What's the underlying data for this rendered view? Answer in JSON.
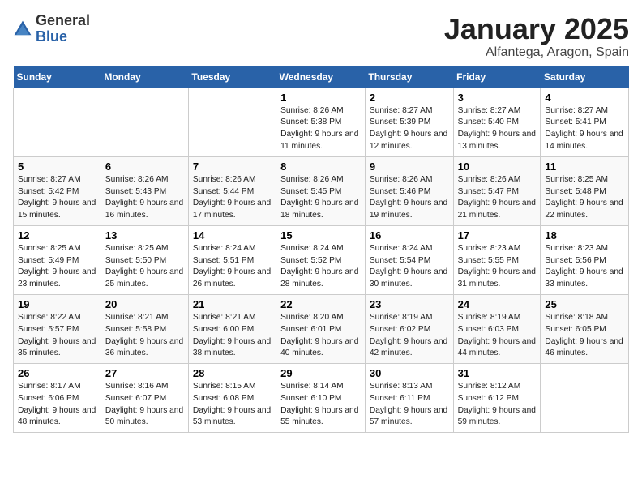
{
  "logo": {
    "general": "General",
    "blue": "Blue"
  },
  "title": "January 2025",
  "location": "Alfantega, Aragon, Spain",
  "days_of_week": [
    "Sunday",
    "Monday",
    "Tuesday",
    "Wednesday",
    "Thursday",
    "Friday",
    "Saturday"
  ],
  "weeks": [
    [
      {
        "day": "",
        "info": ""
      },
      {
        "day": "",
        "info": ""
      },
      {
        "day": "",
        "info": ""
      },
      {
        "day": "1",
        "info": "Sunrise: 8:26 AM\nSunset: 5:38 PM\nDaylight: 9 hours and 11 minutes."
      },
      {
        "day": "2",
        "info": "Sunrise: 8:27 AM\nSunset: 5:39 PM\nDaylight: 9 hours and 12 minutes."
      },
      {
        "day": "3",
        "info": "Sunrise: 8:27 AM\nSunset: 5:40 PM\nDaylight: 9 hours and 13 minutes."
      },
      {
        "day": "4",
        "info": "Sunrise: 8:27 AM\nSunset: 5:41 PM\nDaylight: 9 hours and 14 minutes."
      }
    ],
    [
      {
        "day": "5",
        "info": "Sunrise: 8:27 AM\nSunset: 5:42 PM\nDaylight: 9 hours and 15 minutes."
      },
      {
        "day": "6",
        "info": "Sunrise: 8:26 AM\nSunset: 5:43 PM\nDaylight: 9 hours and 16 minutes."
      },
      {
        "day": "7",
        "info": "Sunrise: 8:26 AM\nSunset: 5:44 PM\nDaylight: 9 hours and 17 minutes."
      },
      {
        "day": "8",
        "info": "Sunrise: 8:26 AM\nSunset: 5:45 PM\nDaylight: 9 hours and 18 minutes."
      },
      {
        "day": "9",
        "info": "Sunrise: 8:26 AM\nSunset: 5:46 PM\nDaylight: 9 hours and 19 minutes."
      },
      {
        "day": "10",
        "info": "Sunrise: 8:26 AM\nSunset: 5:47 PM\nDaylight: 9 hours and 21 minutes."
      },
      {
        "day": "11",
        "info": "Sunrise: 8:25 AM\nSunset: 5:48 PM\nDaylight: 9 hours and 22 minutes."
      }
    ],
    [
      {
        "day": "12",
        "info": "Sunrise: 8:25 AM\nSunset: 5:49 PM\nDaylight: 9 hours and 23 minutes."
      },
      {
        "day": "13",
        "info": "Sunrise: 8:25 AM\nSunset: 5:50 PM\nDaylight: 9 hours and 25 minutes."
      },
      {
        "day": "14",
        "info": "Sunrise: 8:24 AM\nSunset: 5:51 PM\nDaylight: 9 hours and 26 minutes."
      },
      {
        "day": "15",
        "info": "Sunrise: 8:24 AM\nSunset: 5:52 PM\nDaylight: 9 hours and 28 minutes."
      },
      {
        "day": "16",
        "info": "Sunrise: 8:24 AM\nSunset: 5:54 PM\nDaylight: 9 hours and 30 minutes."
      },
      {
        "day": "17",
        "info": "Sunrise: 8:23 AM\nSunset: 5:55 PM\nDaylight: 9 hours and 31 minutes."
      },
      {
        "day": "18",
        "info": "Sunrise: 8:23 AM\nSunset: 5:56 PM\nDaylight: 9 hours and 33 minutes."
      }
    ],
    [
      {
        "day": "19",
        "info": "Sunrise: 8:22 AM\nSunset: 5:57 PM\nDaylight: 9 hours and 35 minutes."
      },
      {
        "day": "20",
        "info": "Sunrise: 8:21 AM\nSunset: 5:58 PM\nDaylight: 9 hours and 36 minutes."
      },
      {
        "day": "21",
        "info": "Sunrise: 8:21 AM\nSunset: 6:00 PM\nDaylight: 9 hours and 38 minutes."
      },
      {
        "day": "22",
        "info": "Sunrise: 8:20 AM\nSunset: 6:01 PM\nDaylight: 9 hours and 40 minutes."
      },
      {
        "day": "23",
        "info": "Sunrise: 8:19 AM\nSunset: 6:02 PM\nDaylight: 9 hours and 42 minutes."
      },
      {
        "day": "24",
        "info": "Sunrise: 8:19 AM\nSunset: 6:03 PM\nDaylight: 9 hours and 44 minutes."
      },
      {
        "day": "25",
        "info": "Sunrise: 8:18 AM\nSunset: 6:05 PM\nDaylight: 9 hours and 46 minutes."
      }
    ],
    [
      {
        "day": "26",
        "info": "Sunrise: 8:17 AM\nSunset: 6:06 PM\nDaylight: 9 hours and 48 minutes."
      },
      {
        "day": "27",
        "info": "Sunrise: 8:16 AM\nSunset: 6:07 PM\nDaylight: 9 hours and 50 minutes."
      },
      {
        "day": "28",
        "info": "Sunrise: 8:15 AM\nSunset: 6:08 PM\nDaylight: 9 hours and 53 minutes."
      },
      {
        "day": "29",
        "info": "Sunrise: 8:14 AM\nSunset: 6:10 PM\nDaylight: 9 hours and 55 minutes."
      },
      {
        "day": "30",
        "info": "Sunrise: 8:13 AM\nSunset: 6:11 PM\nDaylight: 9 hours and 57 minutes."
      },
      {
        "day": "31",
        "info": "Sunrise: 8:12 AM\nSunset: 6:12 PM\nDaylight: 9 hours and 59 minutes."
      },
      {
        "day": "",
        "info": ""
      }
    ]
  ]
}
